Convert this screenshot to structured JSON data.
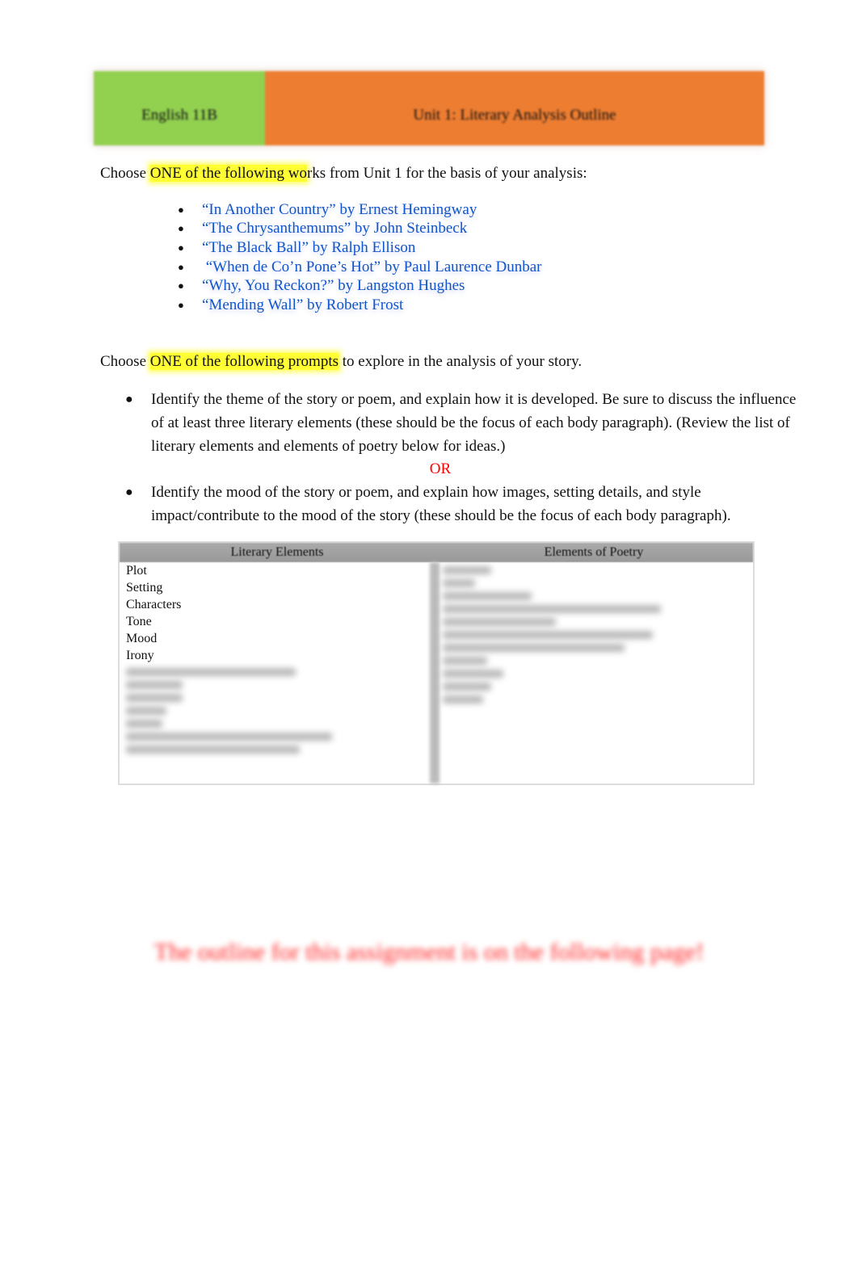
{
  "header": {
    "course": "English 11B",
    "title": "Unit 1: Literary Analysis Outline",
    "colors": {
      "course_bg": "#92d050",
      "title_bg": "#ed7d31"
    }
  },
  "works_intro": {
    "before": "Choose ",
    "highlight": "ONE of the following wo",
    "after": "rks from Unit 1 for the basis of your analysis:"
  },
  "works": [
    "“In Another Country” by Ernest Hemingway",
    "“The Chrysanthemums” by John Steinbeck",
    "“The Black Ball” by Ralph Ellison",
    " “When de Co’n Pone’s Hot” by Paul Laurence Dunbar",
    "“Why, You Reckon?” by Langston Hughes",
    "“Mending Wall” by Robert Frost"
  ],
  "prompts_intro": {
    "before": "Choose ",
    "highlight": "ONE of the following prompts",
    "after": " to explore in the analysis of your story."
  },
  "prompts": [
    "Identify the theme of the story or poem, and explain how it is developed. Be sure to discuss the influence of at least three literary elements (these should be the focus of each body paragraph). (Review the list of literary elements and elements of poetry below for ideas.)",
    "Identify the mood of the story or poem, and explain how images, setting details, and style impact/contribute to the mood of the story (these should be the focus of each body paragraph)."
  ],
  "or_label": "OR",
  "table": {
    "headers": [
      "Literary Elements",
      "Elements of Poetry"
    ],
    "literary_elements": [
      "Plot",
      "Setting",
      "Characters",
      "Tone",
      "Mood",
      "Irony"
    ]
  },
  "bottom_note": "The outline for this assignment is on the following page!"
}
